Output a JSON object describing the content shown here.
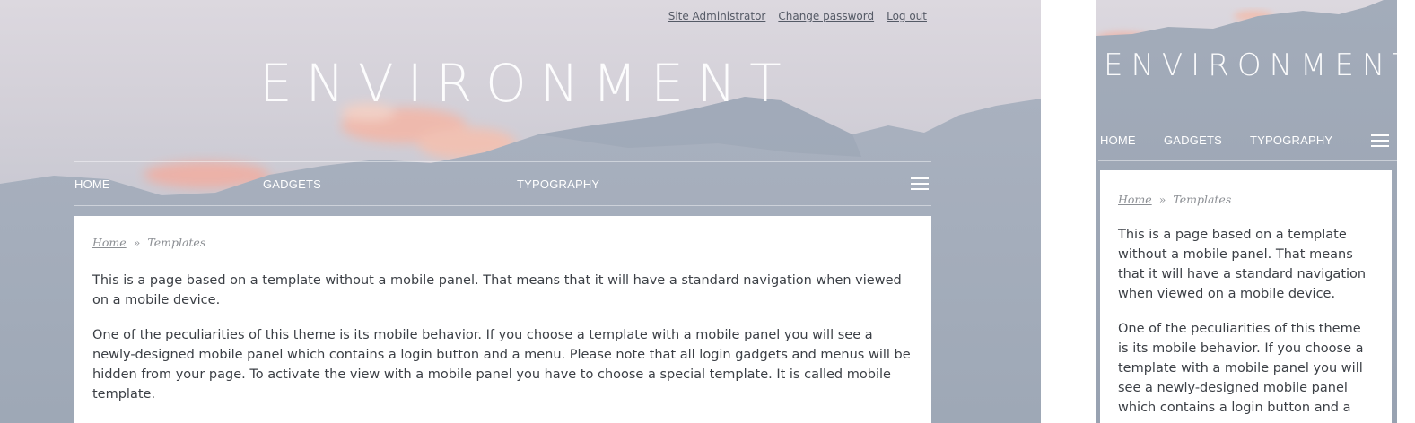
{
  "header_links": [
    {
      "label": "Site Administrator"
    },
    {
      "label": "Change password"
    },
    {
      "label": "Log out"
    }
  ],
  "site_title": "ENVIRONMENT",
  "nav": {
    "items": [
      {
        "label": "HOME"
      },
      {
        "label": "GADGETS"
      },
      {
        "label": "TYPOGRAPHY"
      }
    ],
    "menu_icon": "hamburger-menu-icon"
  },
  "breadcrumb": {
    "home": "Home",
    "separator": "»",
    "current": "Templates"
  },
  "desktop_paragraphs": [
    "This is a page based on a template without a mobile panel. That means that it will have a standard navigation when viewed on a mobile device.",
    "One of the peculiarities of this theme is its mobile behavior. If you choose a template with a mobile panel you will see a newly-designed mobile panel which contains a login button and a menu. Please note that all login gadgets and menus will be hidden from your page. To activate the view with a mobile panel you have to choose a special template. It is called mobile template."
  ],
  "mobile_paragraphs": [
    "This is a page based on a template without a mobile panel. That means that it will have a standard navigation when viewed on a mobile device.",
    "One of the peculiarities of this theme is its mobile behavior. If you choose a template with a mobile panel you will see a newly-designed mobile panel which contains a login button and a"
  ],
  "colors": {
    "sky": "#d8d5dc",
    "mountain": "#a5afbc",
    "cloud": "#f2b3a8",
    "text": "#3b3f45",
    "muted": "#8c8f94"
  }
}
